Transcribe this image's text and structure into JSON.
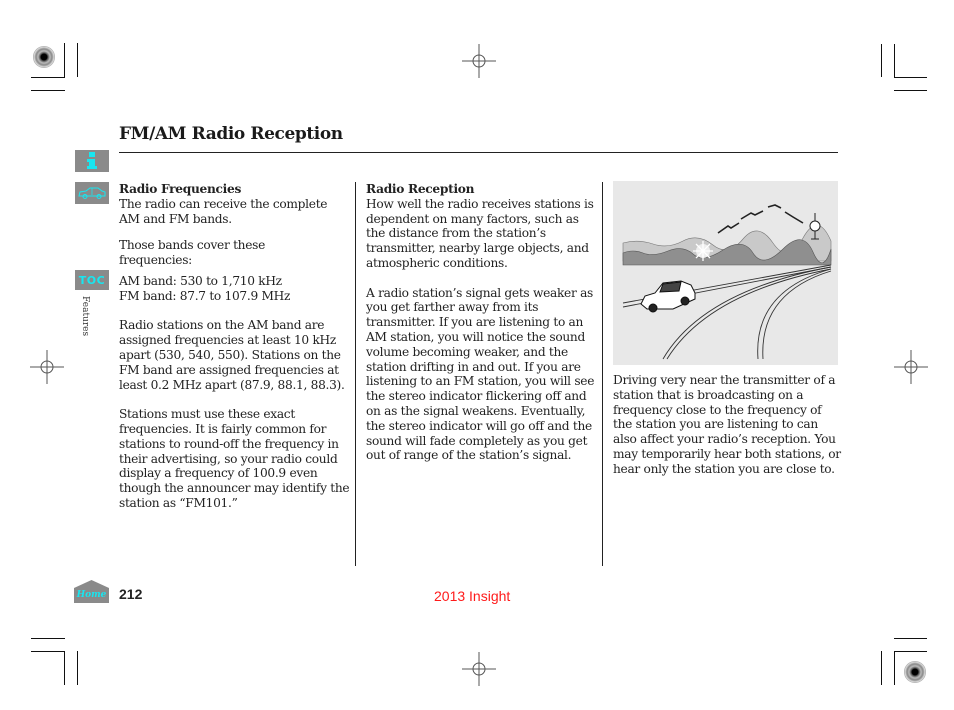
{
  "page": {
    "title": "FM/AM Radio Reception",
    "section_label": "Features",
    "page_number": "212",
    "footer_model": "2013 Insight",
    "colors": {
      "icon_accent": "#18e6f0",
      "footer_text": "#ff1a1a",
      "icon_bg": "#8a8a8a"
    }
  },
  "nav_icons": {
    "info": "info-icon",
    "vehicle": "car-icon",
    "toc_label": "TOC",
    "home_label": "Home"
  },
  "columns": {
    "left": {
      "heading": "Radio Frequencies",
      "paragraphs": [
        "The radio can receive the complete AM and FM bands.",
        "Those bands cover these frequencies:",
        "AM band: 530 to 1,710 kHz",
        "FM band: 87.7 to 107.9 MHz",
        "Radio stations on the AM band are assigned frequencies at least 10 kHz apart (530, 540, 550). Stations on the FM band are assigned frequencies at least 0.2 MHz apart (87.9, 88.1, 88.3).",
        "Stations must use these exact frequencies. It is fairly common for stations to round-off the frequency in their advertising, so your radio could display a frequency of 100.9 even though the announcer may identify the station as “FM101.”"
      ]
    },
    "middle": {
      "heading": "Radio Reception",
      "paragraphs": [
        "How well the radio receives stations is dependent on many factors, such as the distance from the station’s transmitter, nearby large objects, and atmospheric conditions.",
        "A radio station’s signal gets weaker as you get farther away from its transmitter. If you are listening to an AM station, you will notice the sound volume becoming weaker, and the station drifting in and out. If you are listening to an FM station, you will see the stereo indicator flickering off and on as the signal weakens. Eventually, the stereo indicator will go off and the sound will fade completely as you get out of range of the station’s signal."
      ]
    },
    "right": {
      "figure": "car-driving-near-transmitter-illustration",
      "paragraphs": [
        "Driving very near the transmitter of a station that is broadcasting on a frequency close to the frequency of the station you are listening to can also affect your radio’s reception. You may temporarily hear both stations, or hear only the station you are close to."
      ]
    }
  }
}
